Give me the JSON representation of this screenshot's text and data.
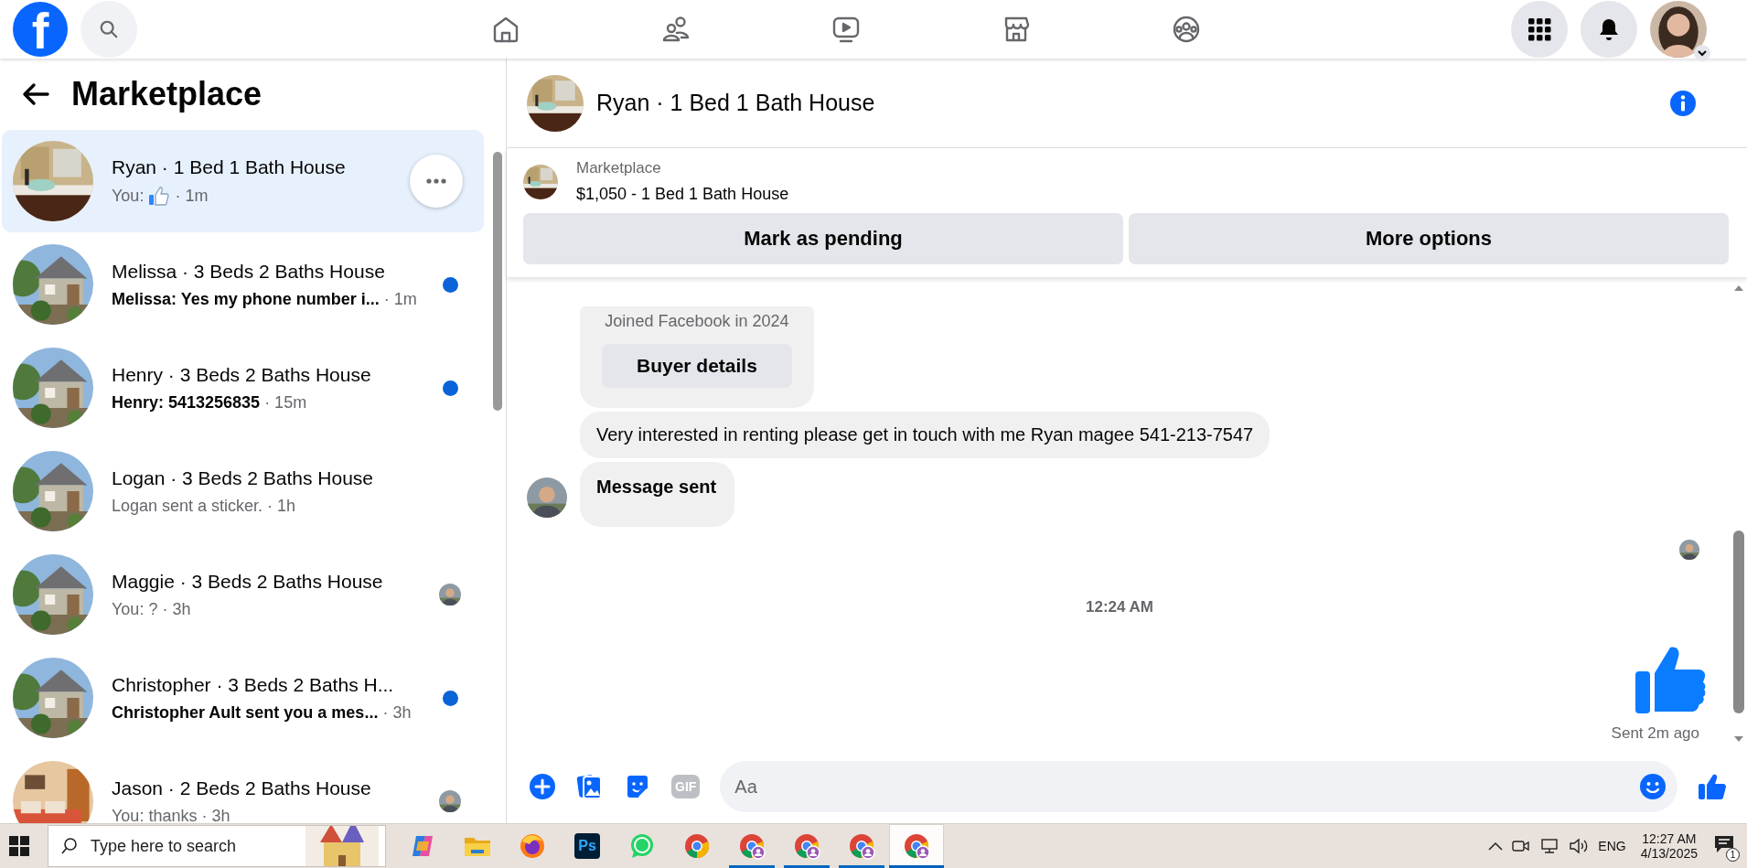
{
  "topbar": {
    "logo": "f",
    "nav": [
      {
        "kind": "home"
      },
      {
        "kind": "friends"
      },
      {
        "kind": "video"
      },
      {
        "kind": "marketplace"
      },
      {
        "kind": "groups"
      }
    ]
  },
  "sidebar": {
    "title": "Marketplace",
    "conversations": [
      {
        "name": "Ryan · 1 Bed 1 Bath House",
        "preview": "You:",
        "liked": true,
        "time": "· 1m",
        "unread": false,
        "seen": false,
        "selected": true
      },
      {
        "name": "Melissa · 3 Beds 2 Baths House",
        "preview": "Melissa: Yes my phone number i...",
        "liked": false,
        "time": "· 1m",
        "unread": true,
        "seen": false,
        "selected": false
      },
      {
        "name": "Henry · 3 Beds 2 Baths House",
        "preview": "Henry: 5413256835",
        "liked": false,
        "time": "· 15m",
        "unread": true,
        "seen": false,
        "selected": false
      },
      {
        "name": "Logan · 3 Beds 2 Baths House",
        "preview": "Logan sent a sticker.",
        "liked": false,
        "time": "· 1h",
        "unread": false,
        "seen": false,
        "selected": false
      },
      {
        "name": "Maggie · 3 Beds 2 Baths House",
        "preview": "You: ?",
        "liked": false,
        "time": "· 3h",
        "unread": false,
        "seen": true,
        "selected": false
      },
      {
        "name": "Christopher · 3 Beds 2 Baths H...",
        "preview": "Christopher Ault sent you a mes...",
        "liked": false,
        "time": "· 3h",
        "unread": true,
        "seen": false,
        "selected": false
      },
      {
        "name": "Jason · 2 Beds 2 Baths House",
        "preview": "You: thanks",
        "liked": false,
        "time": "· 3h",
        "unread": false,
        "seen": true,
        "selected": false
      }
    ]
  },
  "chat": {
    "title": "Ryan · 1 Bed 1 Bath House",
    "listing": {
      "source": "Marketplace",
      "title": "$1,050 - 1 Bed 1 Bath House",
      "actions": [
        "Mark as pending",
        "More options"
      ]
    },
    "messages": [
      {
        "kind": "buyer-card",
        "text": "Joined Facebook in 2024",
        "button": "Buyer details"
      },
      {
        "kind": "text",
        "text": "Very interested in renting please get in touch with me Ryan magee 541-213-7547"
      },
      {
        "kind": "notice",
        "text": "Message sent"
      }
    ],
    "timestamp": "12:24 AM",
    "sent_status": "Sent 2m ago",
    "composer": {
      "placeholder": "Aa",
      "gif_label": "GIF"
    }
  },
  "taskbar": {
    "search_placeholder": "Type here to search",
    "apps": [
      {
        "kind": "copilot",
        "open": false,
        "selected": false
      },
      {
        "kind": "folder",
        "open": false,
        "selected": false
      },
      {
        "kind": "firefox",
        "open": false,
        "selected": false
      },
      {
        "kind": "photoshop",
        "label": "Ps",
        "open": false,
        "selected": false
      },
      {
        "kind": "whatsapp",
        "open": false,
        "selected": false
      },
      {
        "kind": "chrome",
        "open": false,
        "selected": false
      },
      {
        "kind": "chrome-profile",
        "open": true,
        "selected": false
      },
      {
        "kind": "chrome-profile",
        "open": true,
        "selected": false
      },
      {
        "kind": "chrome-profile",
        "open": true,
        "selected": false
      },
      {
        "kind": "chrome-profile",
        "open": true,
        "selected": true
      }
    ],
    "language": "ENG",
    "time": "12:27 AM",
    "date": "4/13/2025",
    "notifications": "1"
  }
}
